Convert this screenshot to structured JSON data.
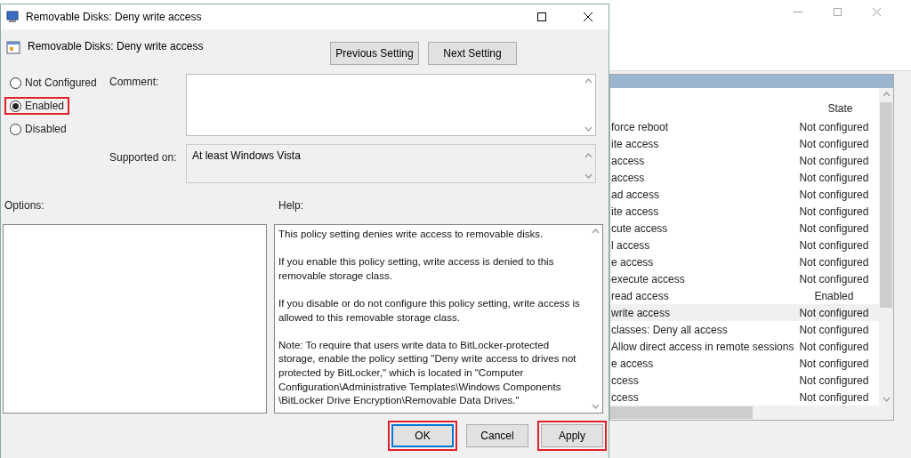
{
  "background_window": {
    "table": {
      "columns": [
        "State"
      ],
      "rows": [
        {
          "name": "force reboot",
          "state": "Not configured",
          "selected": false
        },
        {
          "name": "ite access",
          "state": "Not configured",
          "selected": false
        },
        {
          "name": "access",
          "state": "Not configured",
          "selected": false
        },
        {
          "name": "access",
          "state": "Not configured",
          "selected": false
        },
        {
          "name": "ad access",
          "state": "Not configured",
          "selected": false
        },
        {
          "name": "ite access",
          "state": "Not configured",
          "selected": false
        },
        {
          "name": "cute access",
          "state": "Not configured",
          "selected": false
        },
        {
          "name": "l access",
          "state": "Not configured",
          "selected": false
        },
        {
          "name": "e access",
          "state": "Not configured",
          "selected": false
        },
        {
          "name": "execute access",
          "state": "Not configured",
          "selected": false
        },
        {
          "name": "read access",
          "state": "Enabled",
          "selected": false
        },
        {
          "name": "write access",
          "state": "Not configured",
          "selected": true
        },
        {
          "name": "classes: Deny all access",
          "state": "Not configured",
          "selected": false
        },
        {
          "name": "Allow direct access in remote sessions",
          "state": "Not configured",
          "selected": false
        },
        {
          "name": "e access",
          "state": "Not configured",
          "selected": false
        },
        {
          "name": "ccess",
          "state": "Not configured",
          "selected": false
        },
        {
          "name": "ccess",
          "state": "Not configured",
          "selected": false
        }
      ]
    }
  },
  "dialog": {
    "title": "Removable Disks: Deny write access",
    "heading": "Removable Disks: Deny write access",
    "nav_buttons": [
      "Previous Setting",
      "Next Setting"
    ],
    "options": [
      {
        "label": "Not Configured",
        "selected": false,
        "highlighted": false
      },
      {
        "label": "Enabled",
        "selected": true,
        "highlighted": true
      },
      {
        "label": "Disabled",
        "selected": false,
        "highlighted": false
      }
    ],
    "comment_label": "Comment:",
    "supported_label": "Supported on:",
    "supported_value": "At least Windows Vista",
    "options_label": "Options:",
    "help_label": "Help:",
    "help_paragraphs": [
      "This policy setting denies write access to removable disks.",
      "If you enable this policy setting, write access is denied to this removable storage class.",
      "If you disable or do not configure this policy setting, write access is allowed to this removable storage class.",
      "Note: To require that users write data to BitLocker-protected storage, enable the policy setting \"Deny write access to drives not protected by BitLocker,\" which is located in \"Computer Configuration\\Administrative Templates\\Windows Components \\BitLocker Drive Encryption\\Removable Data Drives.\""
    ],
    "buttons": [
      {
        "label": "OK",
        "default": true,
        "highlighted": true
      },
      {
        "label": "Cancel",
        "default": false,
        "highlighted": false
      },
      {
        "label": "Apply",
        "default": false,
        "highlighted": true
      }
    ]
  }
}
